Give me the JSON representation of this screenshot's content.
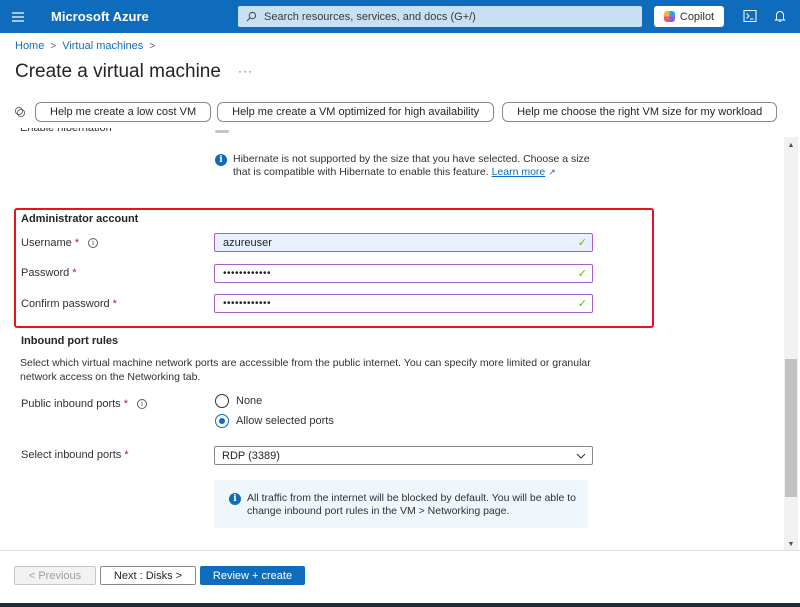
{
  "topbar": {
    "menu_icon": "hamburger-icon",
    "brand": "Microsoft Azure",
    "search_placeholder": "Search resources, services, and docs (G+/)",
    "copilot_label": "Copilot",
    "icons": [
      "cloud-shell-icon",
      "notifications-bell-icon"
    ]
  },
  "breadcrumb": [
    {
      "label": "Home"
    },
    {
      "label": "Virtual machines"
    }
  ],
  "page": {
    "title": "Create a virtual machine",
    "more": "···"
  },
  "help_chips": [
    {
      "label": "Help me create a low cost VM"
    },
    {
      "label": "Help me create a VM optimized for high availability"
    },
    {
      "label": "Help me choose the right VM size for my workload"
    }
  ],
  "hibernation": {
    "label": "Enable hibernation",
    "info": "Hibernate is not supported by the size that you have selected. Choose a size that is compatible with Hibernate to enable this feature.",
    "learn_more": "Learn more"
  },
  "admin_account": {
    "title": "Administrator account",
    "username_label": "Username",
    "username_value": "azureuser",
    "password_label": "Password",
    "password_value": "••••••••••••",
    "confirm_label": "Confirm password",
    "confirm_value": "••••••••••••",
    "required_mark": "*",
    "valid_mark": "✓"
  },
  "inbound": {
    "title": "Inbound port rules",
    "description": "Select which virtual machine network ports are accessible from the public internet. You can specify more limited or granular network access on the Networking tab.",
    "public_ports_label": "Public inbound ports",
    "options": [
      {
        "label": "None",
        "selected": false
      },
      {
        "label": "Allow selected ports",
        "selected": true
      }
    ],
    "select_label": "Select inbound ports",
    "select_value": "RDP (3389)",
    "info": "All traffic from the internet will be blocked by default. You will be able to change inbound port rules in the VM > Networking page."
  },
  "footer": {
    "previous": "< Previous",
    "next": "Next : Disks >",
    "review": "Review + create"
  },
  "colors": {
    "brand_blue": "#0f6cbd",
    "highlight_red": "#e81123",
    "valid_green": "#6bb700",
    "input_border": "#a462c8"
  }
}
